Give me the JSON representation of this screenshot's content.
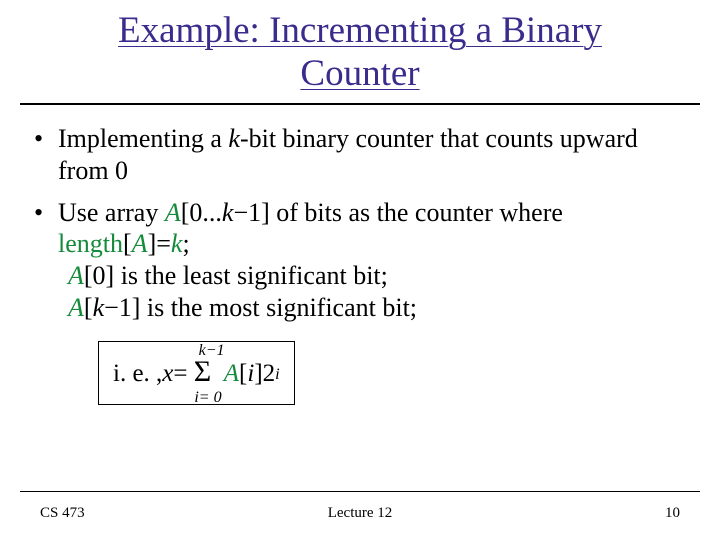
{
  "title": {
    "line1": "Example: Incrementing a Binary",
    "line2": "Counter"
  },
  "bullets": {
    "b1_pre": "Implementing a ",
    "b1_k": "k",
    "b1_post": "-bit binary counter that counts upward from 0",
    "b2_pre": "Use array ",
    "b2_A": "A",
    "b2_br0": "[0...",
    "b2_k": "k",
    "b2_m1": "−1] of bits as the counter where ",
    "b2_len": "length",
    "b2_brA": "[",
    "b2_A2": "A",
    "b2_clA": "]=",
    "b2_k2": "k",
    "b2_semi": ";",
    "b2_line2_A": "A",
    "b2_line2_rest": "[0] is the least significant bit;",
    "b2_line3_A": "A",
    "b2_line3_br": "[",
    "b2_line3_k": "k",
    "b2_line3_rest": "−1] is the most significant bit;"
  },
  "formula": {
    "ie": "i. e. , ",
    "x": "x",
    "eq": "=",
    "sigma_top_k": "k",
    "sigma_top_rest": "−1",
    "sigma_bot_i": "i",
    "sigma_bot_rest": "= 0",
    "A": "A",
    "br_i_open": "[",
    "i": "i",
    "br_i_close": "]2",
    "sup_i": "i"
  },
  "footer": {
    "left": "CS 473",
    "center": "Lecture 12",
    "right": "10"
  }
}
